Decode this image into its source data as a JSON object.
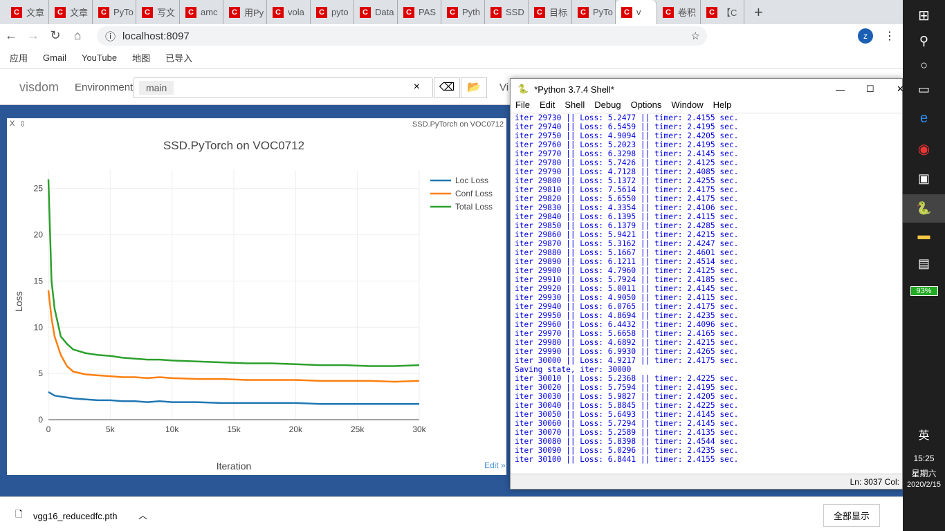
{
  "browser": {
    "tabs": [
      "文章",
      "文章",
      "PyTo",
      "写文",
      "amc",
      "用Py",
      "vola",
      "pyto",
      "Data",
      "PAS",
      "Pyth",
      "SSD",
      "目标",
      "PyTo",
      "v",
      "卷积",
      "【C"
    ],
    "active_tab": 14,
    "url": "localhost:8097",
    "bookmarks": [
      "应用",
      "Gmail",
      "YouTube",
      "地图",
      "已导入"
    ]
  },
  "visdom": {
    "logo": "visdom",
    "env_label": "Environment",
    "env_value": "main",
    "view_label": "Vi"
  },
  "plot": {
    "window_title": "SSD.PyTorch on VOC0712",
    "edit_link": "Edit »",
    "close": "X",
    "pin": "⇩"
  },
  "chart_data": {
    "type": "line",
    "title": "SSD.PyTorch on VOC0712",
    "xlabel": "Iteration",
    "ylabel": "Loss",
    "xlim": [
      0,
      30000
    ],
    "ylim": [
      0,
      27
    ],
    "grid": true,
    "legend": "top-right",
    "xticks": [
      "0",
      "5k",
      "10k",
      "15k",
      "20k",
      "25k",
      "30k"
    ],
    "yticks": [
      "0",
      "5",
      "10",
      "15",
      "20",
      "25"
    ],
    "x": [
      0,
      250,
      500,
      1000,
      1500,
      2000,
      3000,
      4000,
      5000,
      6000,
      7000,
      8000,
      9000,
      10000,
      12000,
      14000,
      16000,
      18000,
      20000,
      22000,
      24000,
      26000,
      28000,
      30000
    ],
    "series": [
      {
        "name": "Loc Loss",
        "color": "#1f77b4",
        "values": [
          3.0,
          2.8,
          2.6,
          2.5,
          2.4,
          2.3,
          2.2,
          2.1,
          2.1,
          2.0,
          2.0,
          1.9,
          2.0,
          1.9,
          1.9,
          1.8,
          1.8,
          1.8,
          1.8,
          1.7,
          1.7,
          1.7,
          1.7,
          1.7
        ]
      },
      {
        "name": "Conf Loss",
        "color": "#ff7f0e",
        "values": [
          14,
          11,
          9,
          7,
          5.8,
          5.2,
          4.9,
          4.8,
          4.7,
          4.6,
          4.6,
          4.5,
          4.6,
          4.5,
          4.4,
          4.4,
          4.3,
          4.3,
          4.3,
          4.2,
          4.2,
          4.2,
          4.1,
          4.2
        ]
      },
      {
        "name": "Total Loss",
        "color": "#2ca02c",
        "values": [
          26,
          15,
          12,
          9,
          8.2,
          7.6,
          7.2,
          7.0,
          6.9,
          6.7,
          6.6,
          6.5,
          6.5,
          6.4,
          6.3,
          6.2,
          6.1,
          6.1,
          6.0,
          5.9,
          5.9,
          5.8,
          5.8,
          5.9
        ]
      }
    ]
  },
  "shell": {
    "title": "*Python 3.7.4 Shell*",
    "menu": [
      "File",
      "Edit",
      "Shell",
      "Debug",
      "Options",
      "Window",
      "Help"
    ],
    "lines": [
      "iter 29730 || Loss: 5.2477 || timer: 2.4155 sec.",
      "iter 29740 || Loss: 6.5459 || timer: 2.4195 sec.",
      "iter 29750 || Loss: 4.9094 || timer: 2.4205 sec.",
      "iter 29760 || Loss: 5.2023 || timer: 2.4195 sec.",
      "iter 29770 || Loss: 6.3298 || timer: 2.4145 sec.",
      "iter 29780 || Loss: 5.7426 || timer: 2.4125 sec.",
      "iter 29790 || Loss: 4.7128 || timer: 2.4085 sec.",
      "iter 29800 || Loss: 5.1372 || timer: 2.4255 sec.",
      "iter 29810 || Loss: 7.5614 || timer: 2.4175 sec.",
      "iter 29820 || Loss: 5.6550 || timer: 2.4175 sec.",
      "iter 29830 || Loss: 4.3354 || timer: 2.4106 sec.",
      "iter 29840 || Loss: 6.1395 || timer: 2.4115 sec.",
      "iter 29850 || Loss: 6.1379 || timer: 2.4285 sec.",
      "iter 29860 || Loss: 5.9421 || timer: 2.4215 sec.",
      "iter 29870 || Loss: 5.3162 || timer: 2.4247 sec.",
      "iter 29880 || Loss: 5.1667 || timer: 2.4601 sec.",
      "iter 29890 || Loss: 6.1211 || timer: 2.4514 sec.",
      "iter 29900 || Loss: 4.7960 || timer: 2.4125 sec.",
      "iter 29910 || Loss: 5.7924 || timer: 2.4185 sec.",
      "iter 29920 || Loss: 5.0011 || timer: 2.4145 sec.",
      "iter 29930 || Loss: 4.9050 || timer: 2.4115 sec.",
      "iter 29940 || Loss: 6.0765 || timer: 2.4175 sec.",
      "iter 29950 || Loss: 4.8694 || timer: 2.4235 sec.",
      "iter 29960 || Loss: 6.4432 || timer: 2.4096 sec.",
      "iter 29970 || Loss: 5.6658 || timer: 2.4165 sec.",
      "iter 29980 || Loss: 4.6892 || timer: 2.4215 sec.",
      "iter 29990 || Loss: 6.9930 || timer: 2.4265 sec.",
      "iter 30000 || Loss: 4.9217 || timer: 2.4175 sec.",
      "Saving state, iter: 30000",
      "iter 30010 || Loss: 5.2368 || timer: 2.4225 sec.",
      "iter 30020 || Loss: 5.7594 || timer: 2.4195 sec.",
      "iter 30030 || Loss: 5.9827 || timer: 2.4205 sec.",
      "iter 30040 || Loss: 5.8845 || timer: 2.4225 sec.",
      "iter 30050 || Loss: 5.6493 || timer: 2.4145 sec.",
      "iter 30060 || Loss: 5.7294 || timer: 2.4145 sec.",
      "iter 30070 || Loss: 5.2589 || timer: 2.4135 sec.",
      "iter 30080 || Loss: 5.8398 || timer: 2.4544 sec.",
      "iter 30090 || Loss: 5.0296 || timer: 2.4235 sec.",
      "iter 30100 || Loss: 6.8441 || timer: 2.4155 sec."
    ],
    "status": "Ln: 3037  Col:"
  },
  "taskbar": {
    "battery": "93%",
    "ime": "英",
    "time": "15:25",
    "weekday": "星期六",
    "date": "2020/2/15"
  },
  "download": {
    "file": "vgg16_reducedfc.pth",
    "show_all": "全部显示"
  }
}
